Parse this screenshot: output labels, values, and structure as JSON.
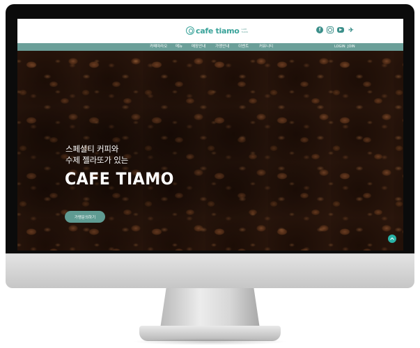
{
  "header": {
    "logo": {
      "name": "cafe tiamo",
      "sub": "CAFE TIAMO"
    },
    "social": [
      {
        "icon": "facebook-icon",
        "glyph": "f"
      },
      {
        "icon": "instagram-icon",
        "glyph": ""
      },
      {
        "icon": "youtube-icon",
        "glyph": "▶"
      },
      {
        "icon": "twitter-icon",
        "glyph": "✈"
      }
    ]
  },
  "nav": {
    "items": [
      "카페따라오",
      "메뉴",
      "매장안내",
      "가맹안내",
      "이벤트",
      "커뮤니티"
    ],
    "login": "LOGIN",
    "join": "JOIN"
  },
  "hero": {
    "line1": "스페셜티 커피와",
    "line2": "수제 젤라또가 있는",
    "title": "CAFE TIAMO",
    "button": "가맹문의하기"
  },
  "colors": {
    "brand": "#3aa39a",
    "nav_bar": "#6b9f99",
    "button": "#5f9b92",
    "scroll_top": "#29b2a6"
  }
}
